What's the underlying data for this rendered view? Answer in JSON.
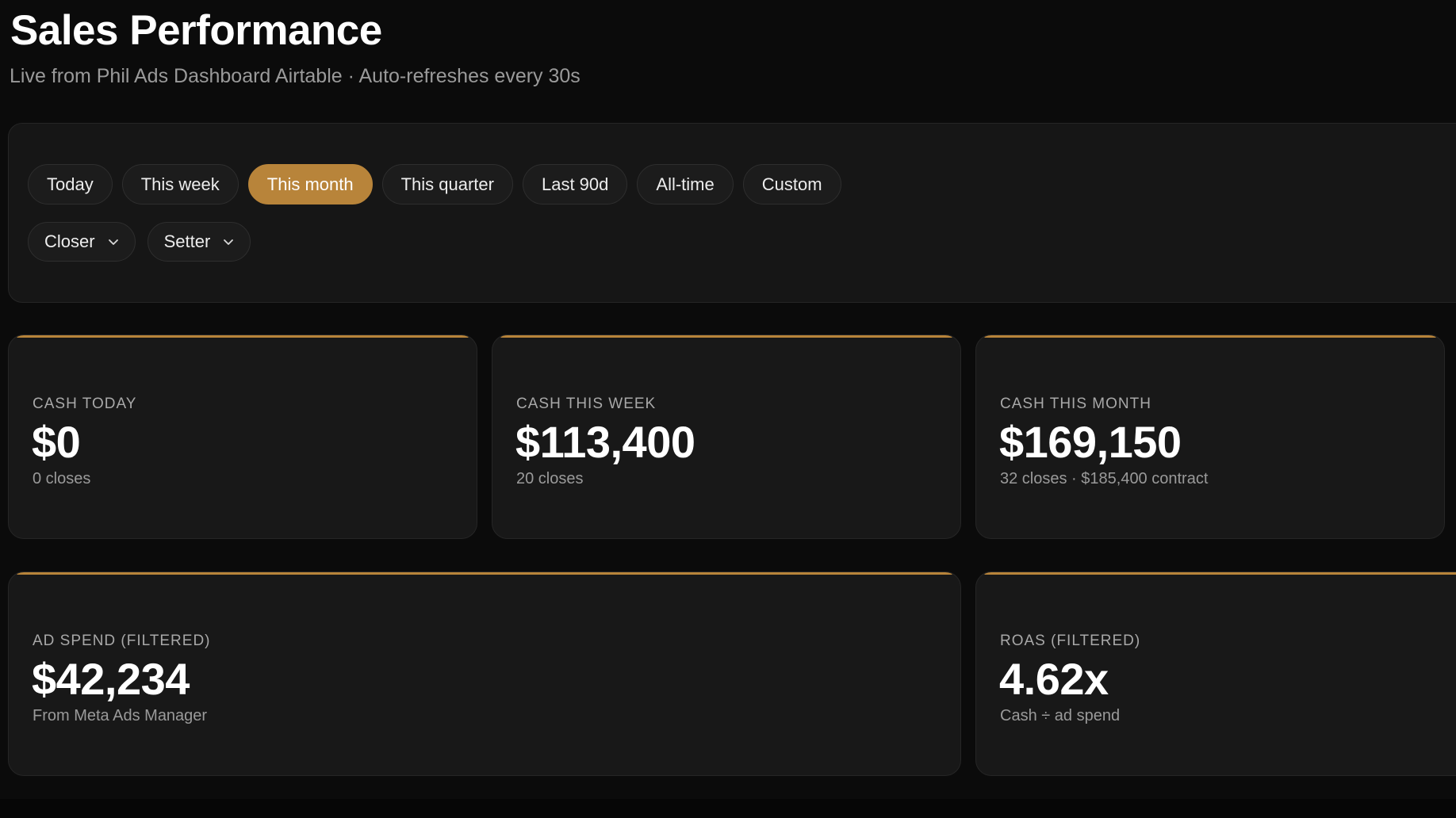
{
  "header": {
    "title": "Sales Performance",
    "subtitle": "Live from Phil Ads Dashboard Airtable · Auto-refreshes every 30s"
  },
  "filters": {
    "ranges": [
      {
        "label": "Today",
        "active": false
      },
      {
        "label": "This week",
        "active": false
      },
      {
        "label": "This month",
        "active": true
      },
      {
        "label": "This quarter",
        "active": false
      },
      {
        "label": "Last 90d",
        "active": false
      },
      {
        "label": "All-time",
        "active": false
      },
      {
        "label": "Custom",
        "active": false
      }
    ],
    "closer_label": "Closer",
    "setter_label": "Setter"
  },
  "metrics": {
    "cash_today": {
      "label": "CASH TODAY",
      "value": "$0",
      "sub": "0 closes"
    },
    "cash_week": {
      "label": "CASH THIS WEEK",
      "value": "$113,400",
      "sub": "20 closes"
    },
    "cash_month": {
      "label": "CASH THIS MONTH",
      "value": "$169,150",
      "sub": "32 closes · $185,400 contract"
    },
    "ad_spend": {
      "label": "AD SPEND (FILTERED)",
      "value": "$42,234",
      "sub": "From Meta Ads Manager"
    },
    "roas": {
      "label": "ROAS (FILTERED)",
      "value": "4.62x",
      "sub": "Cash ÷ ad spend"
    }
  },
  "colors": {
    "accent": "#b8843a",
    "background": "#0b0b0b",
    "card": "#181818"
  },
  "icons": {
    "dropdown": "chevron-down-icon"
  }
}
